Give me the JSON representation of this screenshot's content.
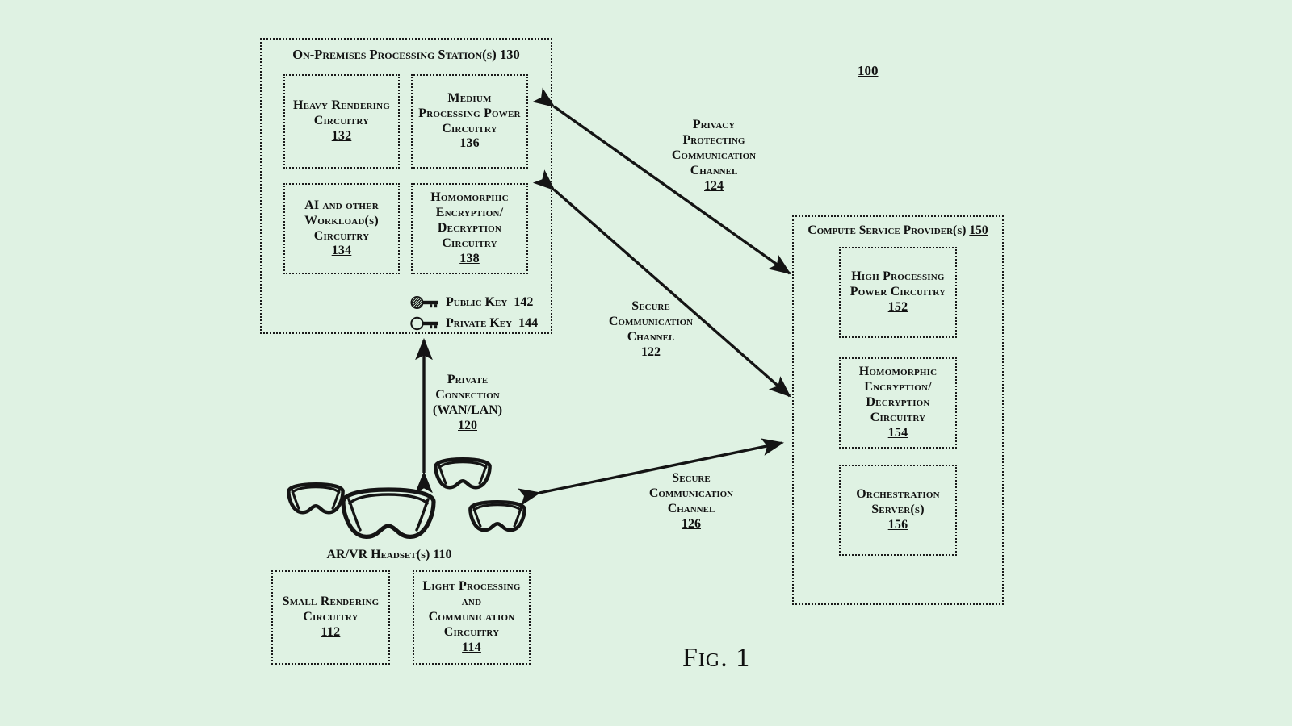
{
  "figure": {
    "caption": "Fig. 1",
    "diagram_number": "100",
    "background_color": "#dff2e3",
    "line_color": "#141414"
  },
  "on_premises": {
    "title": "On-Premises Processing Station(s)",
    "title_number": "130",
    "boxes": [
      {
        "lines": [
          "Heavy Rendering",
          "Circuitry"
        ],
        "number": "132"
      },
      {
        "lines": [
          "Medium",
          "Processing Power",
          "Circuitry"
        ],
        "number": "136"
      },
      {
        "lines": [
          "AI and other",
          "Workload(s)",
          "Circuitry"
        ],
        "number": "134"
      },
      {
        "lines": [
          "Homomorphic",
          "Encryption/",
          "Decryption",
          "Circuitry"
        ],
        "number": "138"
      }
    ],
    "keys": [
      {
        "icon": "public-key-icon",
        "label": "Public Key",
        "number": "142",
        "filled": true
      },
      {
        "icon": "private-key-icon",
        "label": "Private Key",
        "number": "144",
        "filled": false
      }
    ]
  },
  "compute_service_provider": {
    "title": "Compute Service Provider(s)",
    "title_number": "150",
    "boxes": [
      {
        "lines": [
          "High Processing",
          "Power Circuitry"
        ],
        "number": "152"
      },
      {
        "lines": [
          "Homomorphic",
          "Encryption/",
          "Decryption",
          "Circuitry"
        ],
        "number": "154"
      },
      {
        "lines": [
          "Orchestration",
          "Server(s)"
        ],
        "number": "156"
      }
    ]
  },
  "headsets": {
    "title": "AR/VR Headset(s)",
    "title_number": "110",
    "title_number_underlined": false,
    "count": 4,
    "boxes": [
      {
        "lines": [
          "Small Rendering",
          "Circuitry"
        ],
        "number": "112"
      },
      {
        "lines": [
          "Light Processing",
          "and",
          "Communication",
          "Circuitry"
        ],
        "number": "114"
      }
    ]
  },
  "connections": [
    {
      "id": "channel-124",
      "lines": [
        "Privacy",
        "Protecting",
        "Communication",
        "Channel"
      ],
      "number": "124",
      "from": "on-premises-station",
      "to": "compute-service-provider",
      "arrow": "double"
    },
    {
      "id": "channel-122",
      "lines": [
        "Secure",
        "Communication",
        "Channel"
      ],
      "number": "122",
      "from": "on-premises-station",
      "to": "compute-service-provider",
      "arrow": "double"
    },
    {
      "id": "channel-126",
      "lines": [
        "Secure",
        "Communication",
        "Channel"
      ],
      "number": "126",
      "from": "ar-vr-headsets",
      "to": "compute-service-provider",
      "arrow": "double"
    },
    {
      "id": "connection-120",
      "lines": [
        "Private",
        "Connection",
        "(WAN/LAN)"
      ],
      "number": "120",
      "from": "ar-vr-headsets",
      "to": "on-premises-station",
      "arrow": "double"
    }
  ]
}
